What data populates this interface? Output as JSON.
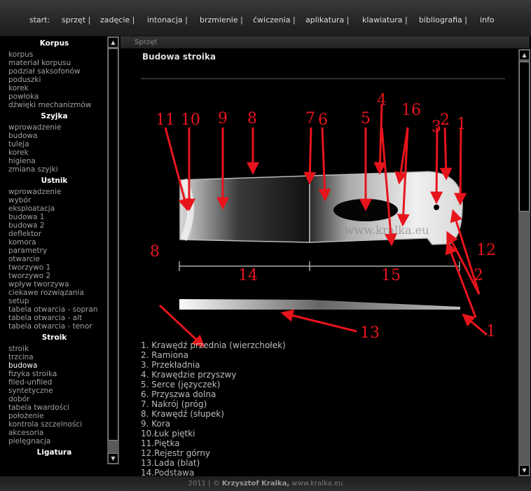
{
  "nav": {
    "items": [
      "start:",
      "sprzęt |",
      "zadęcie |",
      "intonacja |",
      "brzmienie |",
      "ćwiczenia |",
      "aplikatura |",
      "klawiatura |",
      "bibliografia |",
      "info"
    ]
  },
  "sidebar": {
    "sections": [
      {
        "title": "Korpus",
        "items": [
          "korpus",
          "materiał korpusu",
          "podział saksofonów",
          "poduszki",
          "korek",
          "powłoka",
          "dźwięki mechanizmów"
        ]
      },
      {
        "title": "Szyjka",
        "items": [
          "wprowadzenie",
          "budowa",
          "tuleja",
          "korek",
          "higiena",
          "zmiana szyjki"
        ]
      },
      {
        "title": "Ustnik",
        "items": [
          "wprowadzenie",
          "wybór",
          "eksploatacja",
          "budowa 1",
          "budowa 2",
          "deflektor",
          "komora",
          "parametry",
          "otwarcie",
          "tworzywo 1",
          "tworzywo 2",
          "wpływ tworzywa",
          "ciekawe rozwiązania",
          "setup",
          "tabela otwarcia - sopran",
          "tabela otwarcia - alt",
          "tabela otwarcia - tenor"
        ]
      },
      {
        "title": "Stroik",
        "items": [
          "stroik",
          "trzcina",
          "budowa",
          "fizyka stroika",
          "filed-unfiled",
          "syntetyczne",
          "dobór",
          "tabela twardości",
          "położenie",
          "kontrola szczelności",
          "akcesoria",
          "pielęgnacja"
        ]
      },
      {
        "title": "Ligatura",
        "items": []
      }
    ],
    "active": "budowa"
  },
  "breadcrumb": "Sprzęt",
  "page_title": "Budowa stroika",
  "diagram": {
    "numbers": [
      "11",
      "10",
      "9",
      "8",
      "7",
      "6",
      "5",
      "4",
      "16",
      "3",
      "2",
      "1",
      "12",
      "2",
      "14",
      "15",
      "8",
      "13",
      "1"
    ],
    "watermark": "www.kralka.eu",
    "colors": {
      "arrow": "#e8141c",
      "reed": "#d8d8d8"
    }
  },
  "legend": [
    "1. Krawędź przednia (wierzchołek)",
    "2. Ramiona",
    "3. Przekładnia",
    "4. Krawędzie przyszwy",
    "5. Serce (języczek)",
    "6. Przyszwa dolna",
    "7. Nakrój (próg)",
    "8. Krawędź (słupek)",
    "9. Kora",
    "10.Łuk piętki",
    "11.Piętka",
    "12.Rejestr górny",
    "13.Lada (blat)",
    "14.Podstawa"
  ],
  "footer": {
    "year": "2011 |",
    "copy": "©",
    "author": "Krzysztof Kralka,",
    "site": "www.kralka.eu"
  }
}
